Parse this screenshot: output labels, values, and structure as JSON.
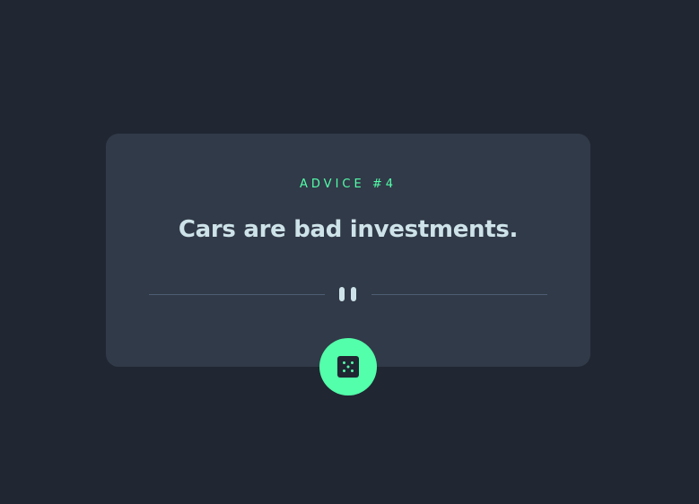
{
  "advice": {
    "label": "ADVICE #4",
    "quote": "Cars are bad investments."
  },
  "divider": {
    "icon": "pause-icon"
  },
  "generate_button": {
    "icon": "dice-icon"
  },
  "colors": {
    "background": "#202632",
    "card": "#313a48",
    "accent": "#53ffaa",
    "text": "#cee3e9",
    "divider": "#4f5d74"
  }
}
